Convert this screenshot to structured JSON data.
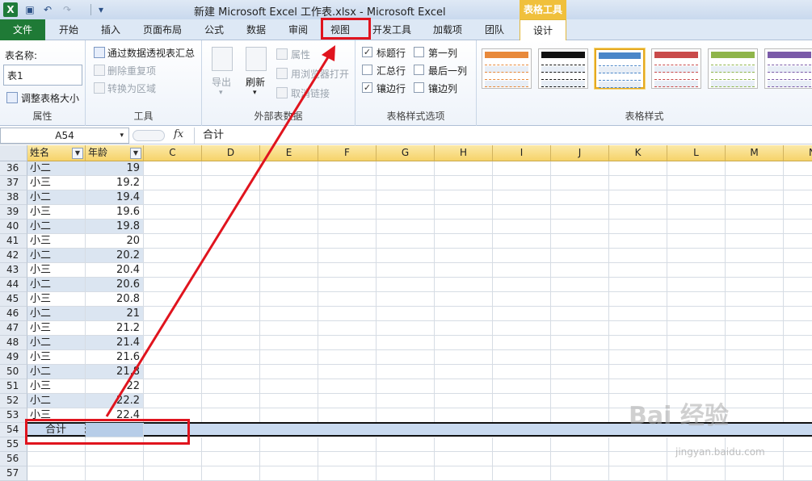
{
  "titlebar": {
    "app_icon": "X",
    "qa_icons": [
      "save-icon",
      "undo-icon",
      "redo-icon",
      "customize-icon"
    ],
    "title": "新建 Microsoft Excel 工作表.xlsx - Microsoft Excel",
    "context_tab_title": "表格工具"
  },
  "tabs": [
    "文件",
    "开始",
    "插入",
    "页面布局",
    "公式",
    "数据",
    "审阅",
    "视图",
    "开发工具",
    "加载项",
    "团队",
    "设计"
  ],
  "ribbon": {
    "properties": {
      "table_name_label": "表名称:",
      "table_name_value": "表1",
      "resize_label": "调整表格大小",
      "group_label": "属性"
    },
    "tools": {
      "pivot_label": "通过数据透视表汇总",
      "remove_dup_label": "删除重复项",
      "convert_label": "转换为区域",
      "group_label": "工具"
    },
    "external": {
      "export_label": "导出",
      "refresh_label": "刷新",
      "props_label": "属性",
      "browser_label": "用浏览器打开",
      "unlink_label": "取消链接",
      "group_label": "外部表数据"
    },
    "style_options": {
      "header_row": "标题行",
      "total_row": "汇总行",
      "banded_rows": "镶边行",
      "first_col": "第一列",
      "last_col": "最后一列",
      "banded_cols": "镶边列",
      "checked_mark": "✓",
      "group_label": "表格样式选项"
    },
    "styles": {
      "group_label": "表格样式",
      "thumb_colors": [
        "#e8893a",
        "#111111",
        "#4a86c8",
        "#c94a4a",
        "#8fb54a",
        "#7a5aa8"
      ]
    }
  },
  "formula_bar": {
    "cell_ref": "A54",
    "fx": "fx",
    "content": "合计"
  },
  "grid": {
    "columns": [
      "C",
      "D",
      "E",
      "F",
      "G",
      "H",
      "I",
      "J",
      "K",
      "L",
      "M",
      "N"
    ],
    "header_a": "姓名",
    "header_b": "年龄",
    "filter_glyph": "▼",
    "rows": [
      {
        "num": "36",
        "name": "小二",
        "age": "19"
      },
      {
        "num": "37",
        "name": "小三",
        "age": "19.2"
      },
      {
        "num": "38",
        "name": "小二",
        "age": "19.4"
      },
      {
        "num": "39",
        "name": "小三",
        "age": "19.6"
      },
      {
        "num": "40",
        "name": "小二",
        "age": "19.8"
      },
      {
        "num": "41",
        "name": "小三",
        "age": "20"
      },
      {
        "num": "42",
        "name": "小二",
        "age": "20.2"
      },
      {
        "num": "43",
        "name": "小三",
        "age": "20.4"
      },
      {
        "num": "44",
        "name": "小二",
        "age": "20.6"
      },
      {
        "num": "45",
        "name": "小三",
        "age": "20.8"
      },
      {
        "num": "46",
        "name": "小二",
        "age": "21"
      },
      {
        "num": "47",
        "name": "小三",
        "age": "21.2"
      },
      {
        "num": "48",
        "name": "小二",
        "age": "21.4"
      },
      {
        "num": "49",
        "name": "小三",
        "age": "21.6"
      },
      {
        "num": "50",
        "name": "小二",
        "age": "21.8"
      },
      {
        "num": "51",
        "name": "小三",
        "age": "22"
      },
      {
        "num": "52",
        "name": "小二",
        "age": "22.2"
      },
      {
        "num": "53",
        "name": "小三",
        "age": "22.4"
      }
    ],
    "total_row": {
      "num": "54",
      "label": "合计"
    },
    "empty_rows": [
      "55",
      "56",
      "57"
    ]
  },
  "annotation": {
    "color": "#e0141e"
  },
  "watermark": {
    "text": "Bai 经验",
    "sub": "jingyan.baidu.com"
  }
}
